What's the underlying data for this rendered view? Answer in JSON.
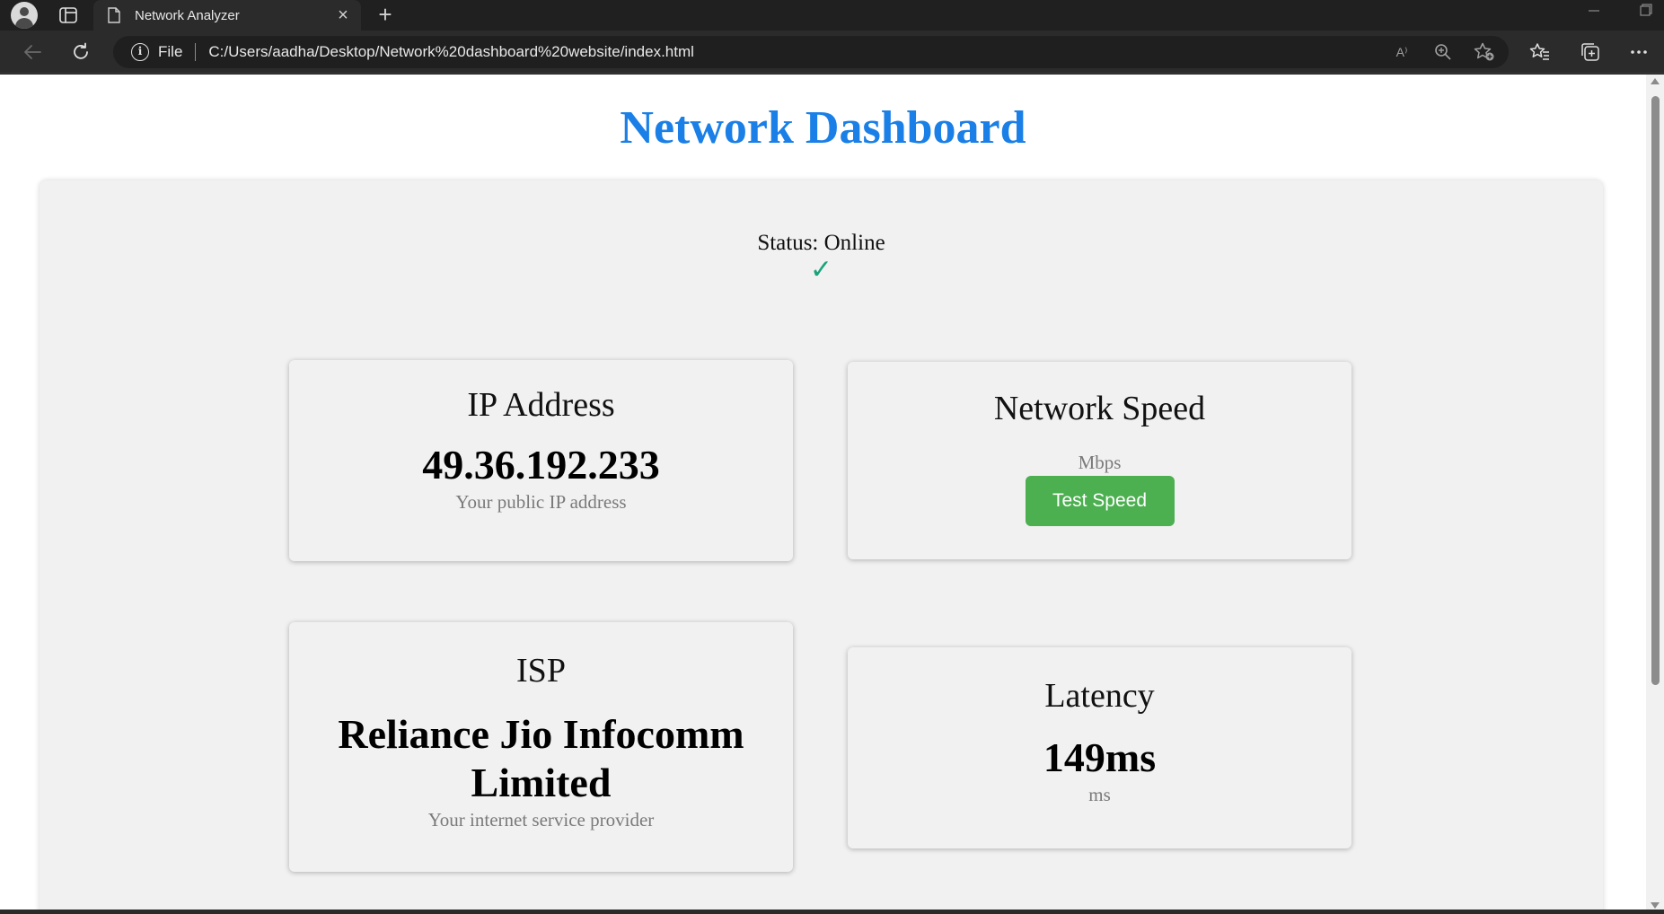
{
  "browser": {
    "tab_title": "Network Analyzer",
    "tab_close": "×",
    "new_tab": "+",
    "scheme_label": "File",
    "url": "C:/Users/aadha/Desktop/Network%20dashboard%20website/index.html",
    "reader_icon_text": "A⁾",
    "icons": [
      "profile-icon",
      "tab-actions-icon",
      "page-icon",
      "back-icon",
      "refresh-icon",
      "info-icon",
      "read-aloud-icon",
      "zoom-icon",
      "add-favorite-icon",
      "favorites-icon",
      "collections-icon",
      "more-icon"
    ]
  },
  "page": {
    "title": "Network Dashboard",
    "status_text": "Status: Online",
    "status_check": "✓",
    "status_color": "#1aa37a",
    "title_color": "#1a7fe6",
    "cards": {
      "ip": {
        "heading": "IP Address",
        "value": "49.36.192.233",
        "sub": "Your public IP address"
      },
      "speed": {
        "heading": "Network Speed",
        "unit": "Mbps",
        "button": "Test Speed",
        "button_color": "#4caf50"
      },
      "isp": {
        "heading": "ISP",
        "value": "Reliance Jio Infocomm Limited",
        "sub": "Your internet service provider"
      },
      "latency": {
        "heading": "Latency",
        "value": "149ms",
        "sub": "ms"
      }
    }
  }
}
